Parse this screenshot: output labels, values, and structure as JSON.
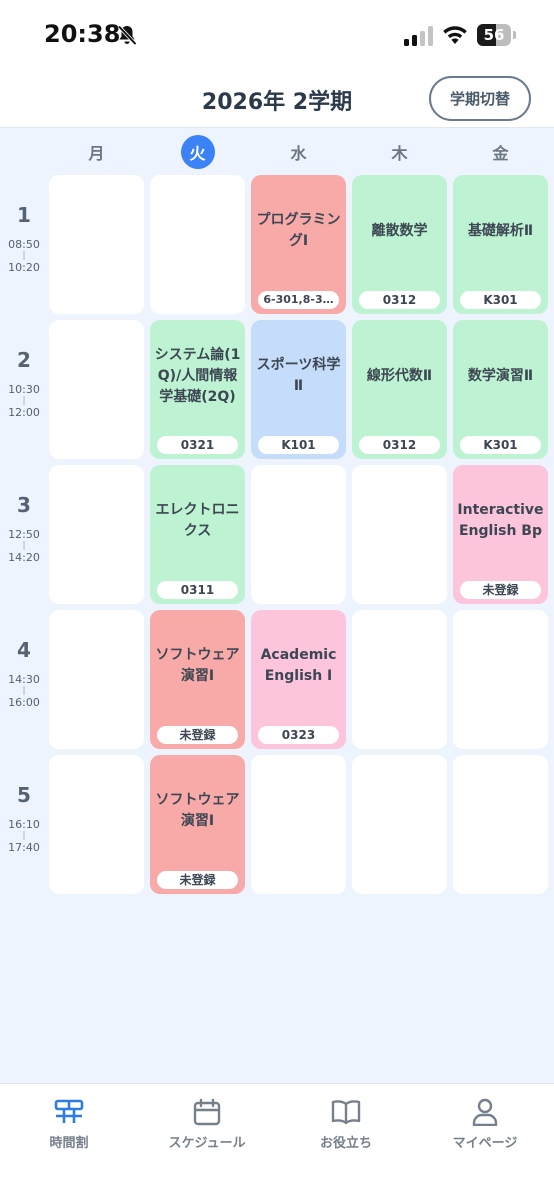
{
  "status": {
    "time": "20:38",
    "battery": "56",
    "battery_level": 0.56
  },
  "header": {
    "title": "2026年 2学期",
    "term_switch_label": "学期切替"
  },
  "days": [
    {
      "label": "月",
      "active": false
    },
    {
      "label": "火",
      "active": true
    },
    {
      "label": "水",
      "active": false
    },
    {
      "label": "木",
      "active": false
    },
    {
      "label": "金",
      "active": false
    }
  ],
  "periods": [
    {
      "num": "1",
      "start": "08:50",
      "end": "10:20"
    },
    {
      "num": "2",
      "start": "10:30",
      "end": "12:00"
    },
    {
      "num": "3",
      "start": "12:50",
      "end": "14:20"
    },
    {
      "num": "4",
      "start": "14:30",
      "end": "16:00"
    },
    {
      "num": "5",
      "start": "16:10",
      "end": "17:40"
    }
  ],
  "colors": {
    "red": "#f8aaa8",
    "green": "#bdf3d2",
    "blue": "#c6dcfb",
    "pink": "#fcc5dc",
    "empty": "#ffffff",
    "accent": "#3b82f6"
  },
  "timetable": [
    [
      {
        "name": "",
        "room": "",
        "color": "empty"
      },
      {
        "name": "",
        "room": "",
        "color": "empty"
      },
      {
        "name": "プログラミングⅠ",
        "room": "6-301,8-3…",
        "color": "red"
      },
      {
        "name": "離散数学",
        "room": "0312",
        "color": "green"
      },
      {
        "name": "基礎解析Ⅱ",
        "room": "K301",
        "color": "green"
      }
    ],
    [
      {
        "name": "",
        "room": "",
        "color": "empty"
      },
      {
        "name": "システム論(1Q)/人間情報学基礎(2Q)",
        "room": "0321",
        "color": "green"
      },
      {
        "name": "スポーツ科学Ⅱ",
        "room": "K101",
        "color": "blue"
      },
      {
        "name": "線形代数Ⅱ",
        "room": "0312",
        "color": "green"
      },
      {
        "name": "数学演習Ⅱ",
        "room": "K301",
        "color": "green"
      }
    ],
    [
      {
        "name": "",
        "room": "",
        "color": "empty"
      },
      {
        "name": "エレクトロニクス",
        "room": "0311",
        "color": "green"
      },
      {
        "name": "",
        "room": "",
        "color": "empty"
      },
      {
        "name": "",
        "room": "",
        "color": "empty"
      },
      {
        "name": "Interactive English Bp",
        "room": "未登録",
        "color": "pink"
      }
    ],
    [
      {
        "name": "",
        "room": "",
        "color": "empty"
      },
      {
        "name": "ソフトウェア演習Ⅰ",
        "room": "未登録",
        "color": "red"
      },
      {
        "name": "Academic English Ⅰ",
        "room": "0323",
        "color": "pink"
      },
      {
        "name": "",
        "room": "",
        "color": "empty"
      },
      {
        "name": "",
        "room": "",
        "color": "empty"
      }
    ],
    [
      {
        "name": "",
        "room": "",
        "color": "empty"
      },
      {
        "name": "ソフトウェア演習Ⅰ",
        "room": "未登録",
        "color": "red"
      },
      {
        "name": "",
        "room": "",
        "color": "empty"
      },
      {
        "name": "",
        "room": "",
        "color": "empty"
      },
      {
        "name": "",
        "room": "",
        "color": "empty"
      }
    ]
  ],
  "tabs": [
    {
      "label": "時間割",
      "icon": "timetable-icon",
      "active": true
    },
    {
      "label": "スケジュール",
      "icon": "calendar-icon",
      "active": false
    },
    {
      "label": "お役立ち",
      "icon": "book-icon",
      "active": false
    },
    {
      "label": "マイページ",
      "icon": "person-icon",
      "active": false
    }
  ]
}
